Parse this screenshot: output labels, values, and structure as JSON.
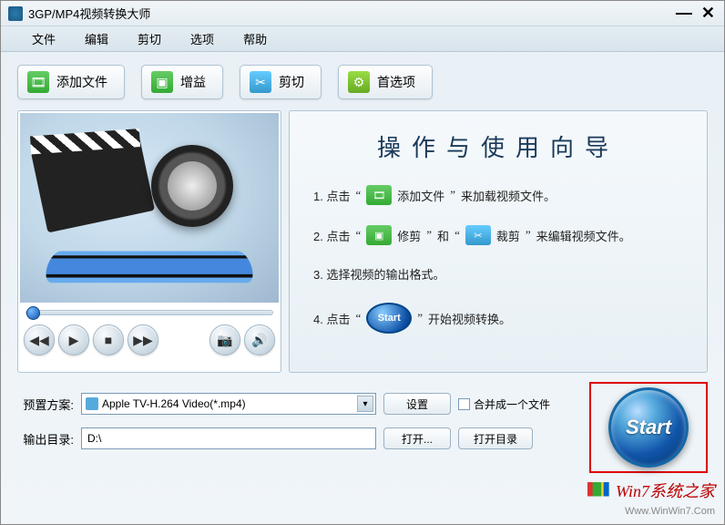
{
  "window": {
    "title": "3GP/MP4视频转换大师"
  },
  "menu": {
    "file": "文件",
    "edit": "编辑",
    "cut": "剪切",
    "options": "选项",
    "help": "帮助"
  },
  "toolbar": {
    "add_file": "添加文件",
    "gain": "增益",
    "cut": "剪切",
    "preferences": "首选项"
  },
  "guide": {
    "title": "操作与使用向导",
    "step1_prefix": "1. 点击",
    "step1_btn": "添加文件",
    "step1_suffix": "来加载视频文件。",
    "step2_prefix": "2. 点击",
    "step2_btn1": "修剪",
    "step2_mid": "和",
    "step2_btn2": "裁剪",
    "step2_suffix": "来编辑视频文件。",
    "step3": "3. 选择视频的输出格式。",
    "step4_prefix": "4. 点击",
    "step4_btn": "Start",
    "step4_suffix": "开始视频转换。"
  },
  "form": {
    "preset_label": "预置方案:",
    "preset_value": "Apple TV-H.264 Video(*.mp4)",
    "settings": "设置",
    "merge_checkbox": "合并成一个文件",
    "output_label": "输出目录:",
    "output_value": "D:\\",
    "open": "打开...",
    "open_dir": "打开目录"
  },
  "start": {
    "label": "Start"
  },
  "watermark": {
    "line1": "Win7系统之家",
    "line2": "Www.WinWin7.Com"
  }
}
